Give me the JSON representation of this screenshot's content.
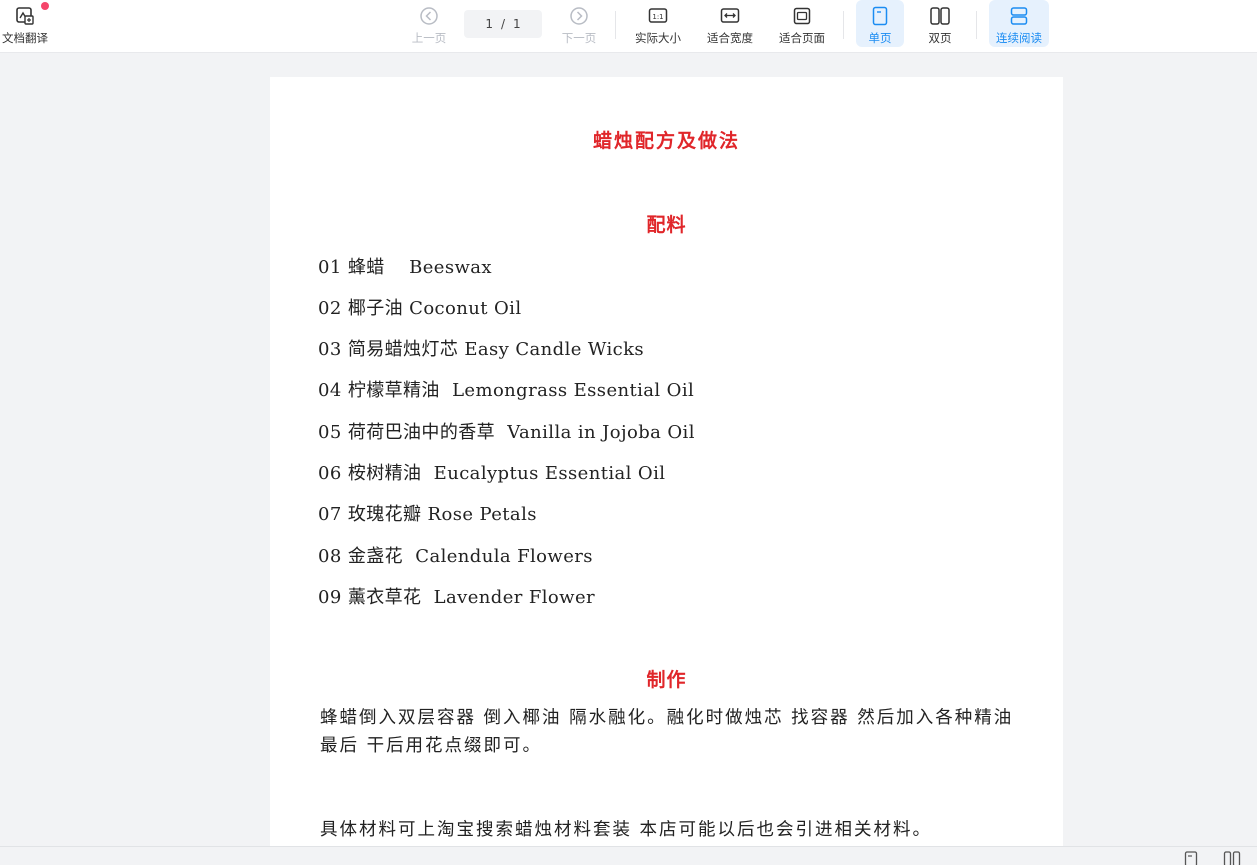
{
  "toolbar": {
    "translate_label": "文档翻译",
    "prev_label": "上一页",
    "page_current": "1",
    "page_sep": "/",
    "page_total": "1",
    "next_label": "下一页",
    "actual_size_label": "实际大小",
    "fit_width_label": "适合宽度",
    "fit_page_label": "适合页面",
    "single_page_label": "单页",
    "double_page_label": "双页",
    "continuous_label": "连续阅读",
    "accent_color": "#1b8cf2"
  },
  "document": {
    "title": "蜡烛配方及做法",
    "ingredients_heading": "配料",
    "ingredients": [
      "01 蜂蜡    Beeswax",
      "02 椰子油 Coconut Oil",
      "03 简易蜡烛灯芯 Easy Candle Wicks",
      "04 柠檬草精油  Lemongrass Essential Oil",
      "05 荷荷巴油中的香草  Vanilla in Jojoba Oil",
      "06 桉树精油  Eucalyptus Essential Oil",
      "07 玫瑰花瓣 Rose Petals",
      "08 金盏花  Calendula Flowers",
      "09 薰衣草花  Lavender Flower"
    ],
    "method_heading": "制作",
    "method_text": "蜂蜡倒入双层容器 倒入椰油 隔水融化。融化时做烛芯 找容器 然后加入各种精油 最后 干后用花点缀即可。",
    "note_text": "具体材料可上淘宝搜索蜡烛材料套装 本店可能以后也会引进相关材料。",
    "heading_color": "#e0262a"
  }
}
